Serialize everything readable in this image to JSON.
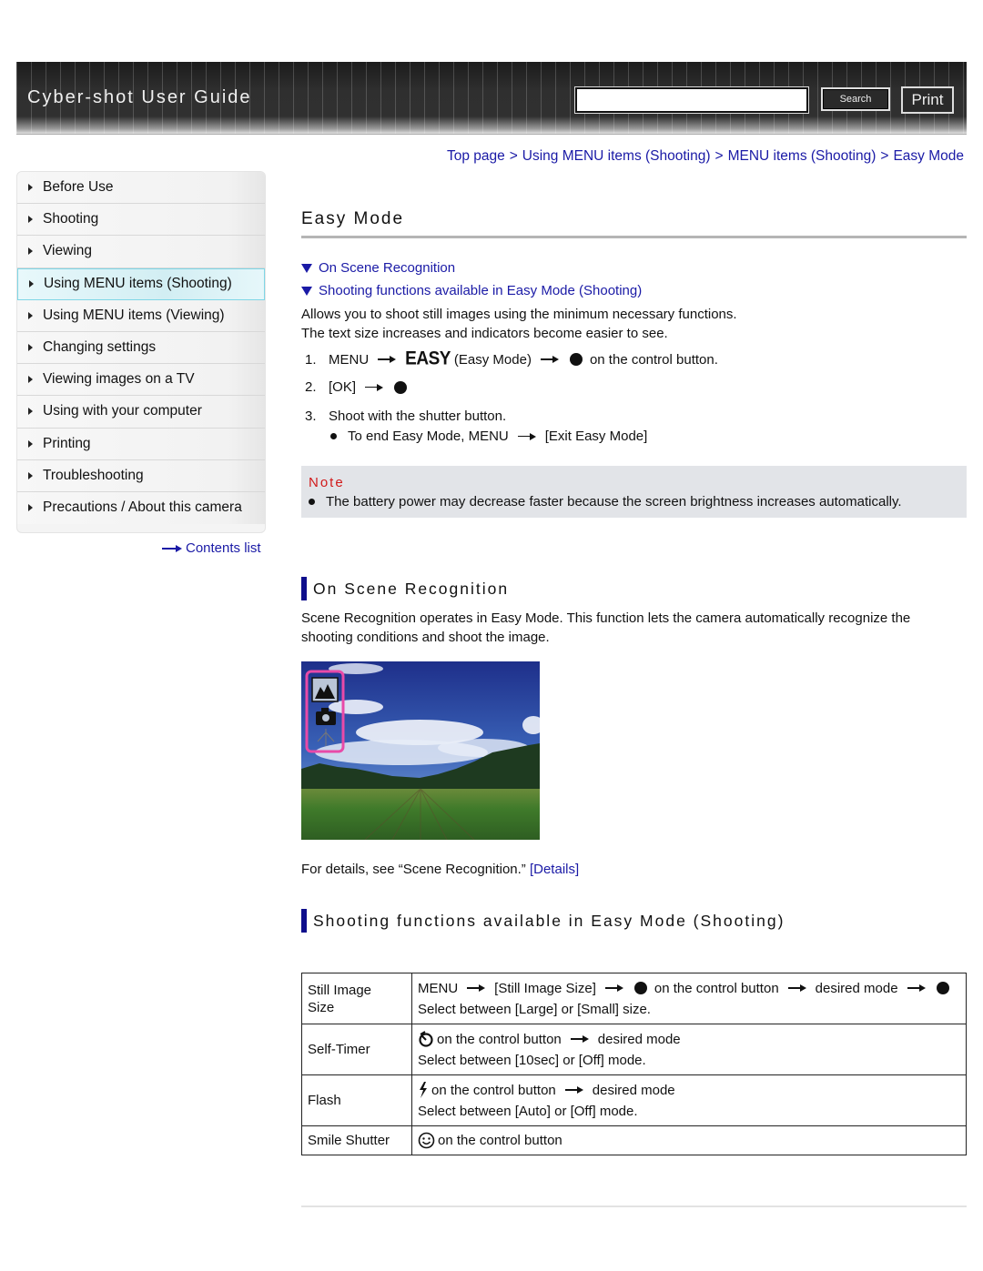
{
  "header": {
    "title": "Cyber-shot User Guide",
    "search_placeholder": "",
    "search_value": "",
    "search_label": "Search",
    "print_label": "Print"
  },
  "sidebar": {
    "items": [
      {
        "label": "Before Use",
        "active": false
      },
      {
        "label": "Shooting",
        "active": false
      },
      {
        "label": "Viewing",
        "active": false
      },
      {
        "label": "Using MENU items (Shooting)",
        "active": true
      },
      {
        "label": "Using MENU items (Viewing)",
        "active": false
      },
      {
        "label": "Changing settings",
        "active": false
      },
      {
        "label": "Viewing images on a TV",
        "active": false
      },
      {
        "label": "Using with your computer",
        "active": false
      },
      {
        "label": "Printing",
        "active": false
      },
      {
        "label": "Troubleshooting",
        "active": false
      },
      {
        "label": "Precautions / About this camera",
        "active": false
      }
    ],
    "contents_link": "Contents list"
  },
  "breadcrumb": {
    "items": [
      "Top page",
      "Using MENU items (Shooting)",
      "MENU items (Shooting)",
      "Easy Mode"
    ],
    "separator": ">"
  },
  "page": {
    "title": "Easy Mode",
    "anchors": [
      "On Scene Recognition",
      "Shooting functions available in Easy Mode (Shooting)"
    ],
    "intro": [
      "Allows you to shoot still images using the minimum necessary functions.",
      "The text size increases and indicators become easier to see."
    ],
    "steps": {
      "s1": {
        "num": "1.",
        "a": "MENU",
        "easy": "EASY",
        "b": "(Easy Mode)",
        "c": "on the control button."
      },
      "s2": {
        "num": "2.",
        "a": "[OK]"
      },
      "s3": {
        "num": "3.",
        "a": "Shoot with the shutter button."
      },
      "sub": {
        "a": "To end Easy Mode, MENU",
        "b": "[Exit Easy Mode]"
      }
    },
    "note": {
      "title": "Note",
      "text": "The battery power may decrease faster because the screen brightness increases automatically."
    },
    "scene": {
      "heading": "On Scene Recognition",
      "text": [
        "Scene Recognition operates in Easy Mode. This function lets the camera automatically recognize the",
        "shooting conditions and shoot the image."
      ],
      "details_text": "For details, see “Scene Recognition.”",
      "details_link": "[Details]"
    },
    "functions": {
      "heading": "Shooting functions available in Easy Mode (Shooting)",
      "rows": [
        {
          "label": "Still Image Size",
          "line1": {
            "a": "MENU",
            "b": "[Still Image Size]",
            "c": "on the control button",
            "d": "desired mode"
          },
          "line2": "Select between [Large] or [Small] size."
        },
        {
          "label": "Self-Timer",
          "line1": {
            "a": "on the control button",
            "b": "desired mode"
          },
          "line2": "Select between [10sec] or [Off] mode."
        },
        {
          "label": "Flash",
          "line1": {
            "a": "on the control button",
            "b": "desired mode"
          },
          "line2": "Select between [Auto] or [Off] mode."
        },
        {
          "label": "Smile Shutter",
          "line1": {
            "a": "on the control button"
          }
        }
      ]
    }
  },
  "colors": {
    "link": "#1a1aa6",
    "note_title": "#d11a1a",
    "section_bar": "#0e0e8c",
    "note_bg": "#e2e4e8",
    "active_nav": "#d2eef3"
  }
}
